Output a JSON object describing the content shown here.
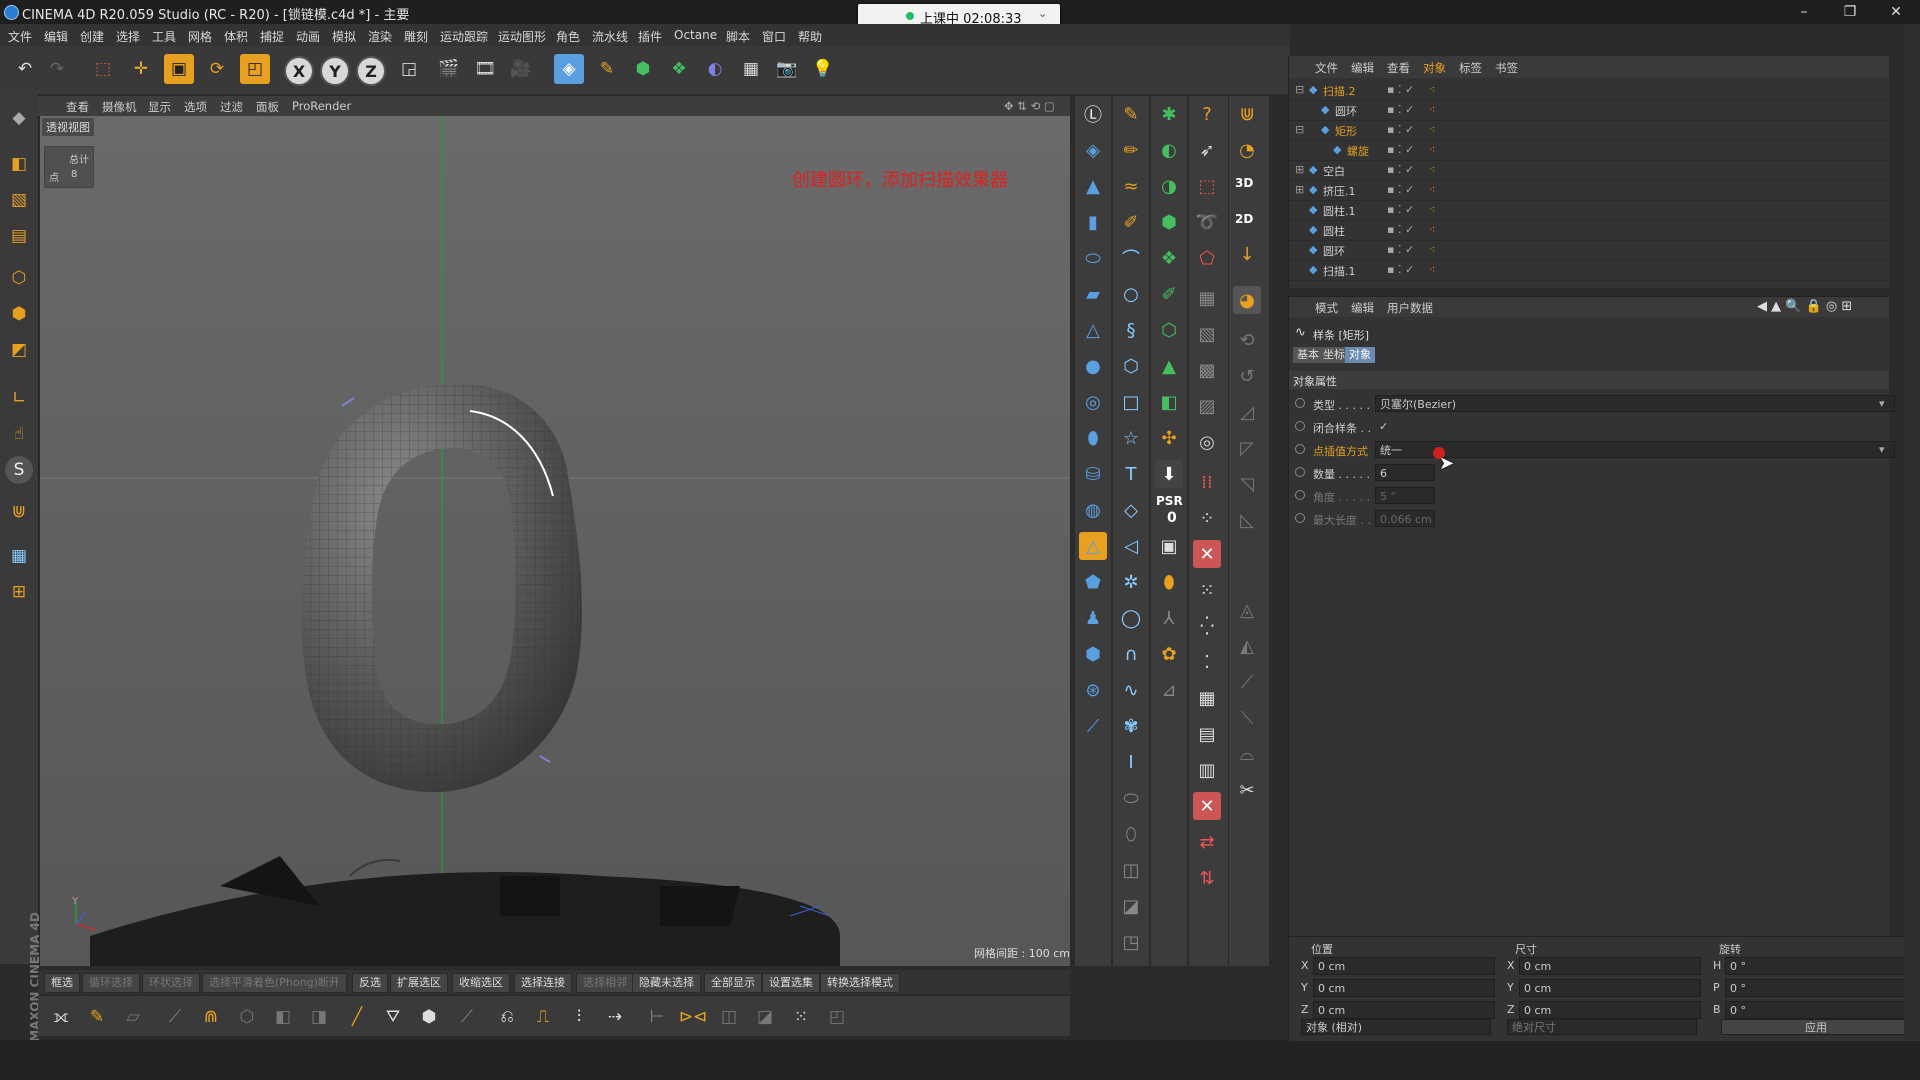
{
  "window": {
    "title": "CINEMA 4D R20.059 Studio (RC - R20) - [锁链模.c4d *] - 主要",
    "minimize": "–",
    "restore": "❐",
    "close": "✕"
  },
  "live_badge": {
    "text": "上课中 02:08:33",
    "chevron": "⌄"
  },
  "menu": [
    "文件",
    "编辑",
    "创建",
    "选择",
    "工具",
    "网格",
    "体积",
    "捕捉",
    "动画",
    "模拟",
    "渲染",
    "雕刻",
    "运动跟踪",
    "运动图形",
    "角色",
    "流水线",
    "插件",
    "Octane",
    "脚本",
    "窗口",
    "帮助"
  ],
  "toolbar": {
    "x": "X",
    "y": "Y",
    "z": "Z"
  },
  "viewport": {
    "menu": [
      "查看",
      "摄像机",
      "显示",
      "选项",
      "过滤",
      "面板",
      "ProRender"
    ],
    "view_name": "透视视图",
    "stats_label": "总计",
    "stats_points_label": "点",
    "stats_points_value": "8",
    "annotation": "创建圆环，添加扫描效果器",
    "grid_spacing": "网格间距 : 100 cm",
    "axis_y": "Y"
  },
  "sel_buttons": [
    "框选",
    "循环选择",
    "环状选择",
    "选择平滑着色(Phong)断开",
    "反选",
    "扩展选区",
    "收缩选区",
    "选择连接",
    "选择相邻",
    "隐藏未选择",
    "全部显示",
    "设置选集",
    "转换选择模式"
  ],
  "sel_buttons_disabled": [
    false,
    true,
    true,
    true,
    false,
    false,
    false,
    false,
    true,
    false,
    false,
    false,
    false
  ],
  "palette_badges": {
    "psr": "PSR",
    "psr_value": "0",
    "label_3d": "3D",
    "label_2d": "2D"
  },
  "object_manager": {
    "tabs": [
      "文件",
      "编辑",
      "查看",
      "对象",
      "标签",
      "书签"
    ],
    "rows": [
      {
        "name": "扫描.2",
        "color": "#e0a020",
        "indent": 0,
        "expand": "⊟"
      },
      {
        "name": "圆环",
        "color": "#cfcfcf",
        "indent": 1,
        "expand": ""
      },
      {
        "name": "矩形",
        "color": "#e0a020",
        "indent": 1,
        "expand": "⊟"
      },
      {
        "name": "螺旋",
        "color": "#e0a020",
        "indent": 2,
        "expand": ""
      },
      {
        "name": "空白",
        "color": "#cfcfcf",
        "indent": 0,
        "expand": "⊞"
      },
      {
        "name": "挤压.1",
        "color": "#cfcfcf",
        "indent": 0,
        "expand": "⊞"
      },
      {
        "name": "圆柱.1",
        "color": "#cfcfcf",
        "indent": 0,
        "expand": ""
      },
      {
        "name": "圆柱",
        "color": "#cfcfcf",
        "indent": 0,
        "expand": ""
      },
      {
        "name": "圆环",
        "color": "#cfcfcf",
        "indent": 0,
        "expand": ""
      },
      {
        "name": "扫描.1",
        "color": "#cfcfcf",
        "indent": 0,
        "expand": ""
      }
    ]
  },
  "attributes": {
    "tabs": [
      "模式",
      "编辑",
      "用户数据"
    ],
    "object_title": "样条 [矩形]",
    "subtabs": [
      "基本",
      "坐标",
      "对象"
    ],
    "section": "对象属性",
    "fields": [
      {
        "label": "类型 . . . . .",
        "value": "贝塞尔(Bezier)",
        "type": "dropdown",
        "label_color": "#cfcfcf"
      },
      {
        "label": "闭合样条 . .",
        "value": "✓",
        "type": "check",
        "label_color": "#cfcfcf"
      },
      {
        "label": "点插值方式",
        "value": "统一",
        "type": "dropdown",
        "label_color": "#e0a020"
      },
      {
        "label": "数量 . . . . .",
        "value": "6",
        "type": "number",
        "label_color": "#cfcfcf"
      },
      {
        "label": "角度 . . . . .",
        "value": "5 °",
        "type": "number",
        "label_color": "#777777"
      },
      {
        "label": "最大长度 . .",
        "value": "0.066 cm",
        "type": "number",
        "label_color": "#777777"
      }
    ]
  },
  "coordinates": {
    "headers": [
      "位置",
      "尺寸",
      "旋转"
    ],
    "position": [
      {
        "axis": "X",
        "value": "0 cm"
      },
      {
        "axis": "Y",
        "value": "0 cm"
      },
      {
        "axis": "Z",
        "value": "0 cm"
      }
    ],
    "size": [
      {
        "axis": "X",
        "value": "0 cm"
      },
      {
        "axis": "Y",
        "value": "0 cm"
      },
      {
        "axis": "Z",
        "value": "0 cm"
      }
    ],
    "rotation": [
      {
        "axis": "H",
        "value": "0 °"
      },
      {
        "axis": "P",
        "value": "0 °"
      },
      {
        "axis": "B",
        "value": "0 °"
      }
    ],
    "mode": "对象 (相对)",
    "size_mode": "绝对尺寸",
    "apply": "应用"
  },
  "brand": "MAXON CINEMA 4D",
  "colors": {
    "accent_orange": "#e0a020",
    "annotation_red": "#e02020",
    "live_green": "#20c060"
  }
}
